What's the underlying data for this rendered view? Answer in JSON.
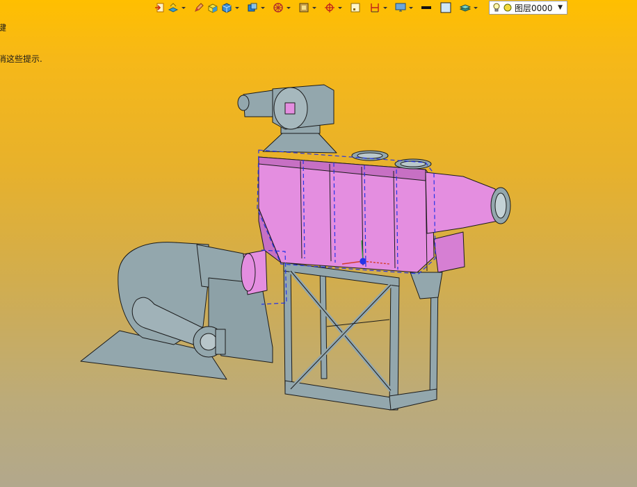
{
  "hint": {
    "line1": "键",
    "line2": "消这些提示."
  },
  "toolbar": {
    "icons": [
      "exit-sketch-icon",
      "layer-tool-icon",
      "pencil-icon",
      "box-icon",
      "cube-icon",
      "view-cube-icon",
      "wheel-icon",
      "render-icon",
      "origin-icon",
      "frame-icon",
      "dimension-icon",
      "monitor-icon",
      "line-color-icon",
      "fill-color-icon",
      "layers-icon"
    ],
    "colors": {
      "line": "#111111",
      "fill": "#cfe6f4"
    }
  },
  "layer": {
    "name": "图层0000"
  },
  "viewport": {
    "colors": {
      "equipment": "#93a7ad",
      "selected": "#e48ee0",
      "edge": "#1a1a1a",
      "highlight": "#2433e8"
    }
  }
}
